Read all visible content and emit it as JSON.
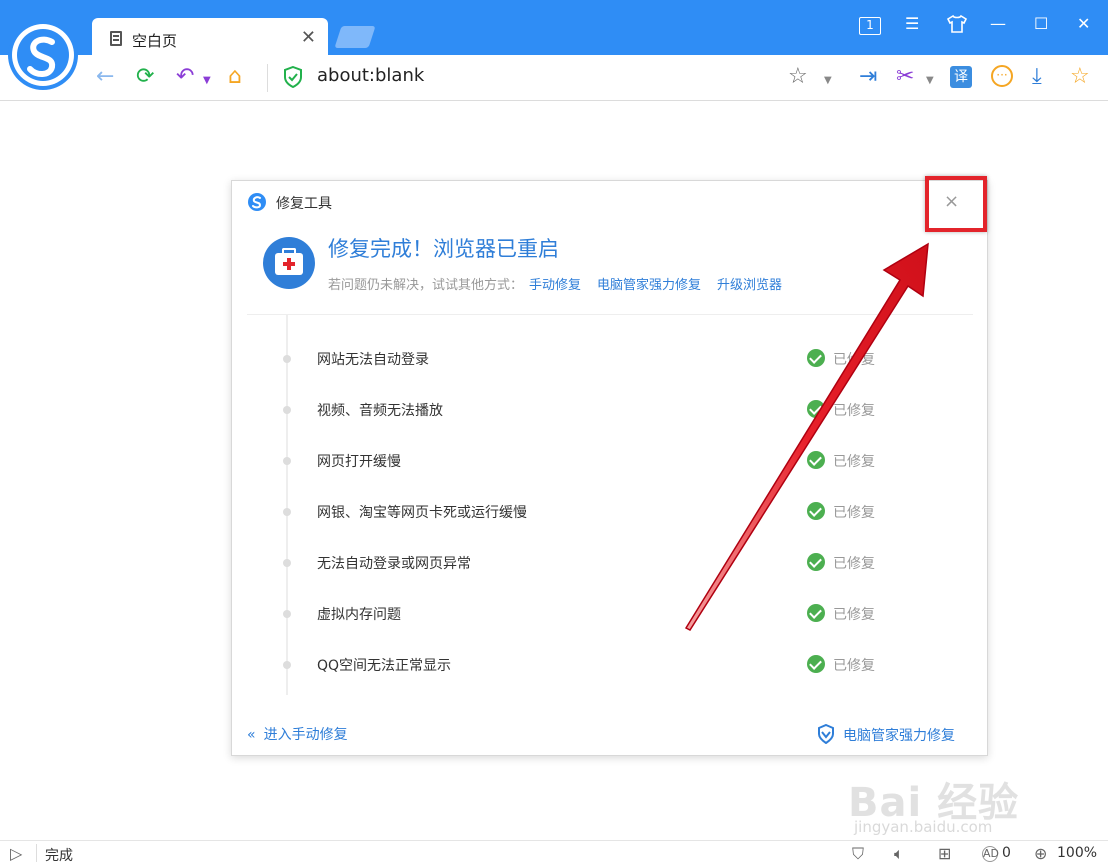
{
  "browser": {
    "tab_title": "空白页",
    "tab_count": "1",
    "address": "about:blank",
    "accent_color": "#2f8df5"
  },
  "dialog": {
    "title": "修复工具",
    "headline": "修复完成！浏览器已重启",
    "subline_prefix": "若问题仍未解决，试试其他方式：",
    "links": [
      "手动修复",
      "电脑管家强力修复",
      "升级浏览器"
    ],
    "items": [
      {
        "label": "网站无法自动登录",
        "status": "已修复"
      },
      {
        "label": "视频、音频无法播放",
        "status": "已修复"
      },
      {
        "label": "网页打开缓慢",
        "status": "已修复"
      },
      {
        "label": "网银、淘宝等网页卡死或运行缓慢",
        "status": "已修复"
      },
      {
        "label": "无法自动登录或网页异常",
        "status": "已修复"
      },
      {
        "label": "虚拟内存问题",
        "status": "已修复"
      },
      {
        "label": "QQ空间无法正常显示",
        "status": "已修复"
      }
    ],
    "footer_left": "进入手动修复",
    "footer_right": "电脑管家强力修复",
    "close_glyph": "×"
  },
  "status": {
    "text": "完成",
    "ad_count": "0",
    "zoom": "100%"
  },
  "watermark": {
    "main": "Bai 经验",
    "sub": "jingyan.baidu.com"
  }
}
